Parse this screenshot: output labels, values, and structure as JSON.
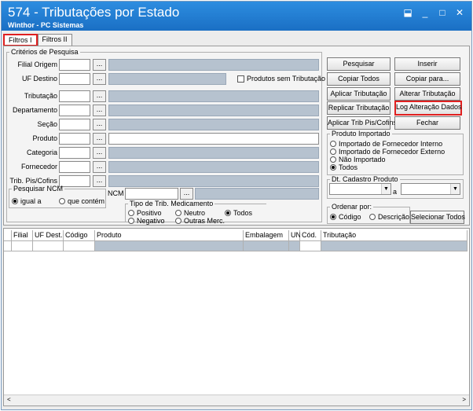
{
  "window": {
    "title": "574 - Tributações por Estado",
    "subtitle": "Winthor - PC Sistemas",
    "controls": [
      "⬓",
      "_",
      "□",
      "✕"
    ]
  },
  "tabs": [
    {
      "label": "Filtros I",
      "active": true
    },
    {
      "label": "Filtros II",
      "active": false
    }
  ],
  "criteria": {
    "legend": "Critérios de Pesquisa",
    "fields": [
      {
        "label": "Filial Origem"
      },
      {
        "label": "UF Destino"
      },
      {
        "label": "Tributação"
      },
      {
        "label": "Departamento"
      },
      {
        "label": "Seção"
      },
      {
        "label": "Produto"
      },
      {
        "label": "Categoria"
      },
      {
        "label": "Fornecedor"
      },
      {
        "label": "Trib. Pis/Cofins"
      }
    ],
    "dots": "...",
    "sem_tributacao": "Produtos sem Tributação"
  },
  "ncm": {
    "legend": "Pesquisar NCM",
    "label": "NCM",
    "options": [
      "igual a",
      "que contém"
    ],
    "selected": "igual a"
  },
  "trib_med": {
    "legend": "Tipo de Trib. Medicamento",
    "options": [
      "Positivo",
      "Neutro",
      "Todos",
      "Negativo",
      "Outras Merc."
    ],
    "selected": "Todos"
  },
  "buttons": {
    "pesquisar": "Pesquisar",
    "inserir": "Inserir",
    "copiar_todos": "Copiar Todos",
    "copiar_para": "Copiar para...",
    "aplicar_tributacao": "Aplicar Tributação",
    "alterar_tributacao": "Alterar Tributação",
    "replicar_tributacao": "Replicar Tributação",
    "log_alteracao": "Log Alteração Dados",
    "aplicar_trib_pis": "Aplicar Trib Pis/Cofins",
    "fechar": "Fechar"
  },
  "produto_importado": {
    "legend": "Produto Importado",
    "options": [
      "Importado de Fornecedor Interno",
      "Importado de Fornecedor Externo",
      "Não Importado",
      "Todos"
    ],
    "selected": "Todos"
  },
  "dt_cadastro": {
    "legend": "Dt. Cadastro Produto",
    "separator": "a"
  },
  "ordenar": {
    "legend": "Ordenar por:",
    "options": [
      "Código",
      "Descrição"
    ],
    "selected": "Código",
    "select_all": "Selecionar Todos"
  },
  "grid": {
    "columns": [
      "Filial",
      "UF Dest.",
      "Código",
      "Produto",
      "Embalagem",
      "UN",
      "Cód.",
      "Tributação"
    ]
  },
  "scroll": {
    "left": "<",
    "right": ">"
  }
}
